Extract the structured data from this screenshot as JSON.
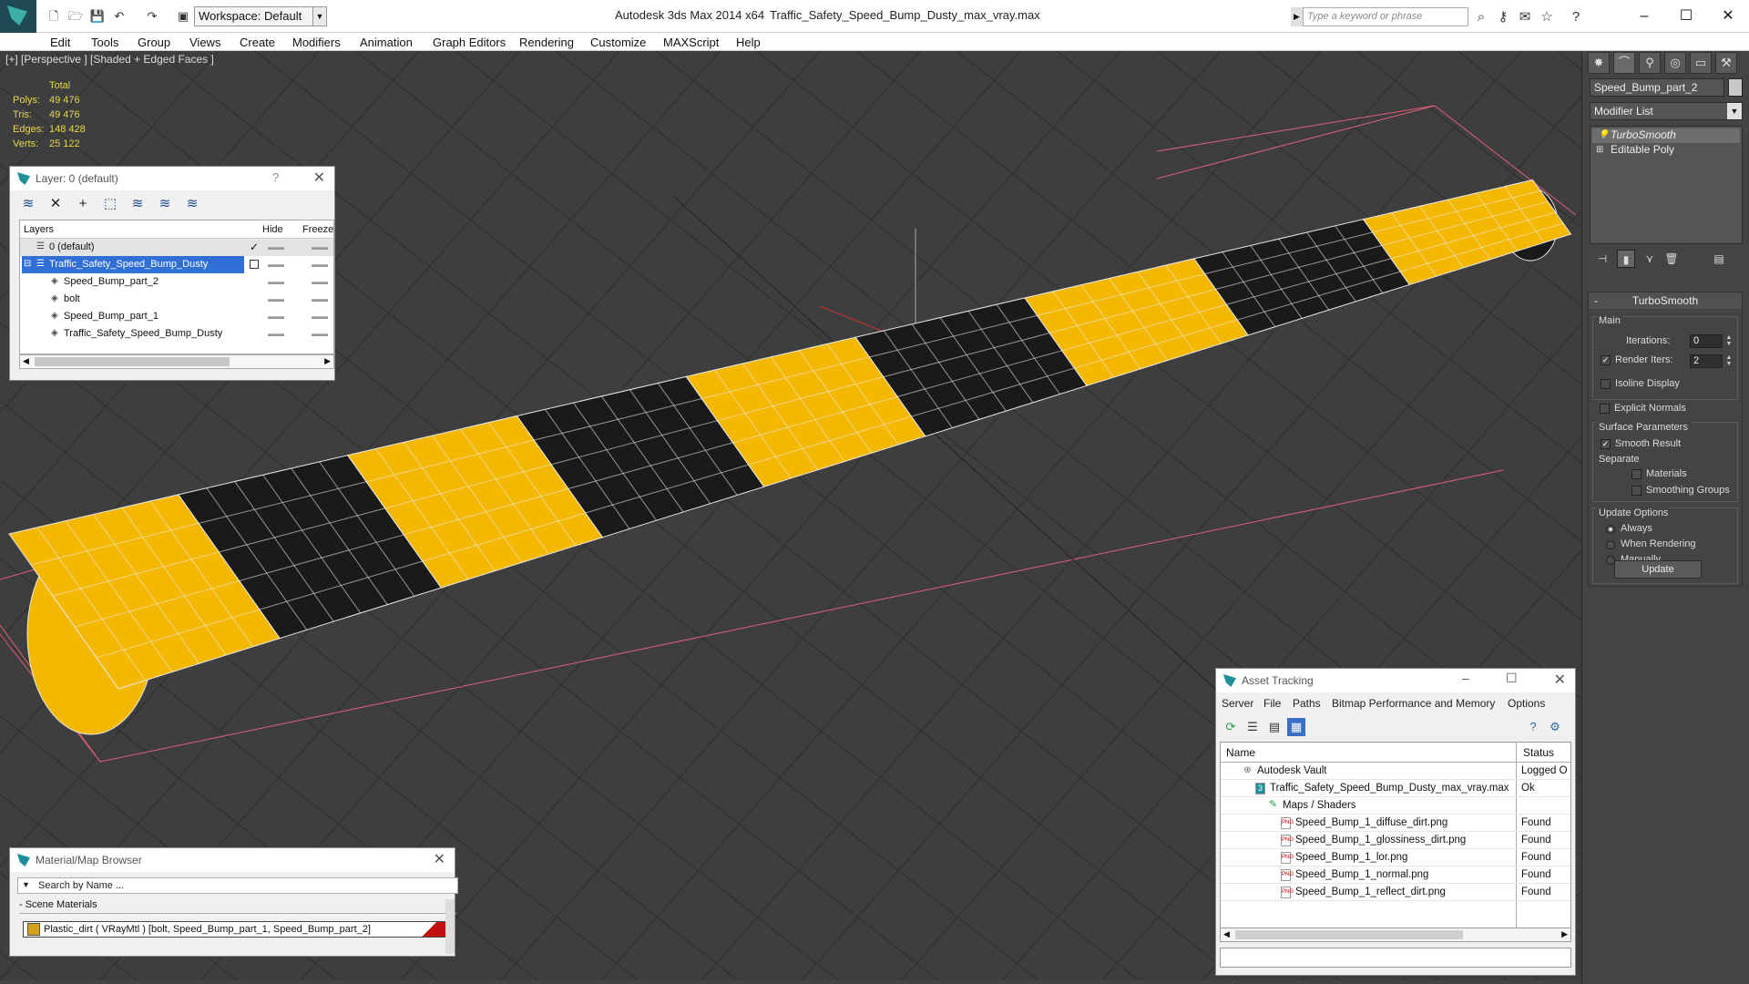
{
  "title_bar": {
    "workspace_label": "Workspace: Default",
    "app_title": "Autodesk 3ds Max  2014 x64",
    "file_title": "Traffic_Safety_Speed_Bump_Dusty_max_vray.max",
    "search_placeholder": "Type a keyword or phrase"
  },
  "menu": [
    "Edit",
    "Tools",
    "Group",
    "Views",
    "Create",
    "Modifiers",
    "Animation",
    "Graph Editors",
    "Rendering",
    "Customize",
    "MAXScript",
    "Help"
  ],
  "viewport": {
    "label": "[+] [Perspective ] [Shaded + Edged Faces ]",
    "stats": {
      "header": "Total",
      "rows": [
        {
          "label": "Polys:",
          "value": "49 476"
        },
        {
          "label": "Tris:",
          "value": "49 476"
        },
        {
          "label": "Edges:",
          "value": "148 428"
        },
        {
          "label": "Verts:",
          "value": "25 122"
        }
      ]
    },
    "colors": {
      "background": "#3e3e3e",
      "grid": "#2f2f2f",
      "yellow": "#f5b800",
      "black": "#1a1a1a",
      "bbox": "#e0607a"
    }
  },
  "layer_panel": {
    "title": "Layer: 0 (default)",
    "columns": {
      "layers": "Layers",
      "hide": "Hide",
      "freeze": "Freeze"
    },
    "rows": [
      {
        "name": "0 (default)",
        "indent": 0,
        "selected": false
      },
      {
        "name": "Traffic_Safety_Speed_Bump_Dusty",
        "indent": 0,
        "selected": true
      },
      {
        "name": "Speed_Bump_part_2",
        "indent": 1,
        "selected": false
      },
      {
        "name": "bolt",
        "indent": 1,
        "selected": false
      },
      {
        "name": "Speed_Bump_part_1",
        "indent": 1,
        "selected": false
      },
      {
        "name": "Traffic_Safety_Speed_Bump_Dusty",
        "indent": 1,
        "selected": false
      }
    ]
  },
  "material_browser": {
    "title": "Material/Map Browser",
    "search_placeholder": "Search by Name ...",
    "section": "- Scene Materials",
    "material": "Plastic_dirt  ( VRayMtl ) [bolt, Speed_Bump_part_1, Speed_Bump_part_2]"
  },
  "asset_tracking": {
    "title": "Asset Tracking",
    "menu": [
      "Server",
      "File",
      "Paths",
      "Bitmap Performance and Memory",
      "Options"
    ],
    "columns": {
      "name": "Name",
      "status": "Status"
    },
    "rows": [
      {
        "name": "Autodesk Vault",
        "status": "Logged O",
        "icon": "vault-icon"
      },
      {
        "name": "Traffic_Safety_Speed_Bump_Dusty_max_vray.max",
        "status": "Ok",
        "icon": "max-file-icon"
      },
      {
        "name": "Maps / Shaders",
        "status": "",
        "icon": "maps-icon"
      },
      {
        "name": "Speed_Bump_1_diffuse_dirt.png",
        "status": "Found",
        "icon": "png-icon"
      },
      {
        "name": "Speed_Bump_1_glossiness_dirt.png",
        "status": "Found",
        "icon": "png-icon"
      },
      {
        "name": "Speed_Bump_1_lor.png",
        "status": "Found",
        "icon": "png-icon"
      },
      {
        "name": "Speed_Bump_1_normal.png",
        "status": "Found",
        "icon": "png-icon"
      },
      {
        "name": "Speed_Bump_1_reflect_dirt.png",
        "status": "Found",
        "icon": "png-icon"
      }
    ]
  },
  "command_panel": {
    "object_name": "Speed_Bump_part_2",
    "modifier_list": "Modifier List",
    "stack": [
      "TurboSmooth",
      "Editable Poly"
    ],
    "turbosmooth": {
      "title": "TurboSmooth",
      "main": "Main",
      "iterations_label": "Iterations:",
      "iterations": "0",
      "render_iters_label": "Render Iters:",
      "render_iters": "2",
      "isoline": "Isoline Display",
      "explicit": "Explicit Normals",
      "surface": "Surface Parameters",
      "smooth_result": "Smooth Result",
      "separate": "Separate",
      "materials": "Materials",
      "smoothing_groups": "Smoothing Groups",
      "update_options": "Update Options",
      "always": "Always",
      "when_rendering": "When Rendering",
      "manually": "Manually",
      "update": "Update"
    }
  }
}
